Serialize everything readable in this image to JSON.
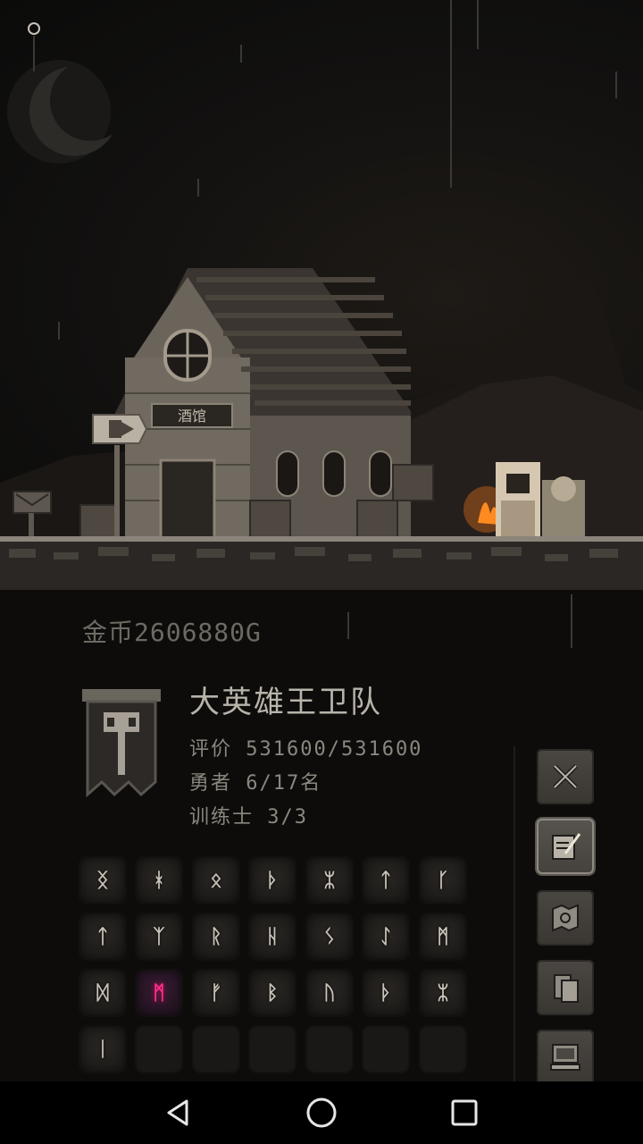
{
  "top": {
    "settings_icon": "gear-icon"
  },
  "scene": {
    "tavern_sign_text": "酒馆",
    "signpost_icon": "exit-arrow-icon"
  },
  "gold": {
    "label": "金币2606880G"
  },
  "guild": {
    "name": "大英雄王卫队",
    "rating": "评价 531600/531600",
    "heroes": "勇者 6/17名",
    "trainers": "训练士 3/3",
    "banner_icon": "hammer-banner-icon"
  },
  "runes": {
    "row1": [
      "ᛝ",
      "ᚼ",
      "ᛟ",
      "ᚦ",
      "ᛯ",
      "ᛏ",
      "ᚴ"
    ],
    "row2": [
      "ᛏ",
      "ᛉ",
      "ᚱ",
      "ᚺ",
      "ᛊ",
      "ᛇ",
      "ᛗ"
    ],
    "row3": [
      "ᛞ",
      "ᛗ",
      "ᚠ",
      "ᛒ",
      "ᚢ",
      "ᚦ",
      "ᛯ"
    ],
    "row4": [
      "ᛁ",
      "",
      "",
      "",
      "",
      "",
      ""
    ],
    "active_index": "row3-1"
  },
  "side_menu": {
    "items": [
      {
        "name": "battle",
        "icon": "crossed-swords-icon"
      },
      {
        "name": "quest",
        "icon": "scroll-quill-icon",
        "selected": true
      },
      {
        "name": "map",
        "icon": "map-icon"
      },
      {
        "name": "documents",
        "icon": "documents-icon"
      },
      {
        "name": "system",
        "icon": "computer-icon"
      }
    ]
  },
  "navbar": {
    "back": "back-triangle-icon",
    "home": "home-circle-icon",
    "recents": "recents-square-icon"
  },
  "colors": {
    "accent_rune": "#ff2f8a",
    "text_primary": "#b8b3aa",
    "text_secondary": "#8b877f",
    "gold_text": "#6e6a63"
  }
}
